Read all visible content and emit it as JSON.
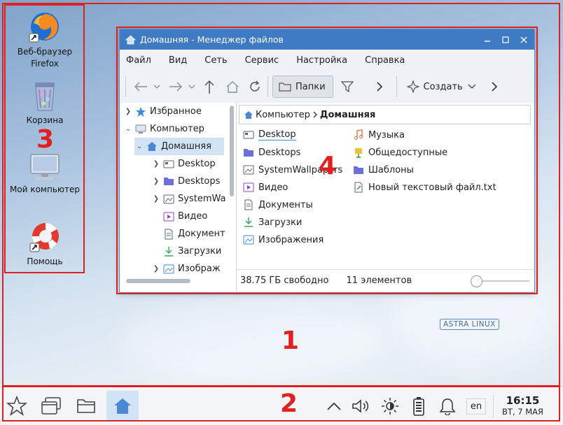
{
  "annotations": {
    "region_1": "1",
    "region_2": "2",
    "region_3": "3",
    "region_4": "4",
    "color": "#e02020"
  },
  "desktop": {
    "icons": [
      {
        "label_line1": "Веб-браузер",
        "label_line2": "Firefox",
        "icon": "firefox-icon"
      },
      {
        "label": "Корзина",
        "icon": "trash-icon"
      },
      {
        "label": "Мой компьютер",
        "icon": "computer-icon"
      },
      {
        "label": "Помощь",
        "icon": "lifebuoy-icon"
      }
    ],
    "watermark": "ASTRA LINUX"
  },
  "window": {
    "title": "Домашняя - Менеджер файлов",
    "controls": [
      "minimize-icon",
      "maximize-icon",
      "close-icon"
    ],
    "menu": [
      "Файл",
      "Вид",
      "Сеть",
      "Сервис",
      "Настройка",
      "Справка"
    ],
    "toolbar": {
      "folders_label": "Папки",
      "create_label": "Создать"
    },
    "tree": [
      {
        "label": "Избранное",
        "icon": "star-icon",
        "expand": "collapsed"
      },
      {
        "label": "Компьютер",
        "icon": "computer-icon",
        "expand": "expanded"
      },
      {
        "label": "Домашняя",
        "icon": "home-icon",
        "expand": "expanded",
        "selected": true
      },
      {
        "label": "Desktop",
        "icon": "desktop-folder-icon",
        "expand": "collapsed"
      },
      {
        "label": "Desktops",
        "icon": "folder-icon",
        "expand": "collapsed"
      },
      {
        "label": "SystemWa",
        "icon": "wallpaper-folder-icon",
        "expand": "collapsed"
      },
      {
        "label": "Видео",
        "icon": "video-folder-icon",
        "expand": "none"
      },
      {
        "label": "Документ",
        "icon": "documents-folder-icon",
        "expand": "none"
      },
      {
        "label": "Загрузки",
        "icon": "downloads-folder-icon",
        "expand": "none"
      },
      {
        "label": "Изображ",
        "icon": "images-folder-icon",
        "expand": "collapsed"
      }
    ],
    "breadcrumb": {
      "root": "Компьютер",
      "current": "Домашняя"
    },
    "files_col1": [
      {
        "label": "Desktop",
        "icon": "desktop-folder-icon"
      },
      {
        "label": "Desktops",
        "icon": "folder-icon"
      },
      {
        "label": "SystemWallpapers",
        "icon": "wallpaper-folder-icon"
      },
      {
        "label": "Видео",
        "icon": "video-folder-icon"
      },
      {
        "label": "Документы",
        "icon": "documents-folder-icon"
      },
      {
        "label": "Загрузки",
        "icon": "downloads-folder-icon"
      },
      {
        "label": "Изображения",
        "icon": "images-folder-icon"
      }
    ],
    "files_col2": [
      {
        "label": "Музыка",
        "icon": "music-folder-icon"
      },
      {
        "label": "Общедоступные",
        "icon": "public-folder-icon"
      },
      {
        "label": "Шаблоны",
        "icon": "templates-folder-icon"
      },
      {
        "label": "Новый текстовый файл.txt",
        "icon": "text-file-icon"
      }
    ],
    "status": {
      "free": "38.75 ГБ свободно",
      "count": "11 элементов",
      "zoom": 0
    }
  },
  "taskbar": {
    "language": "en",
    "time": "16:15",
    "date": "ВТ, 7 МАЯ",
    "colors": {
      "accent": "#3e7bc4",
      "highlight": "#d2e3f6"
    }
  }
}
